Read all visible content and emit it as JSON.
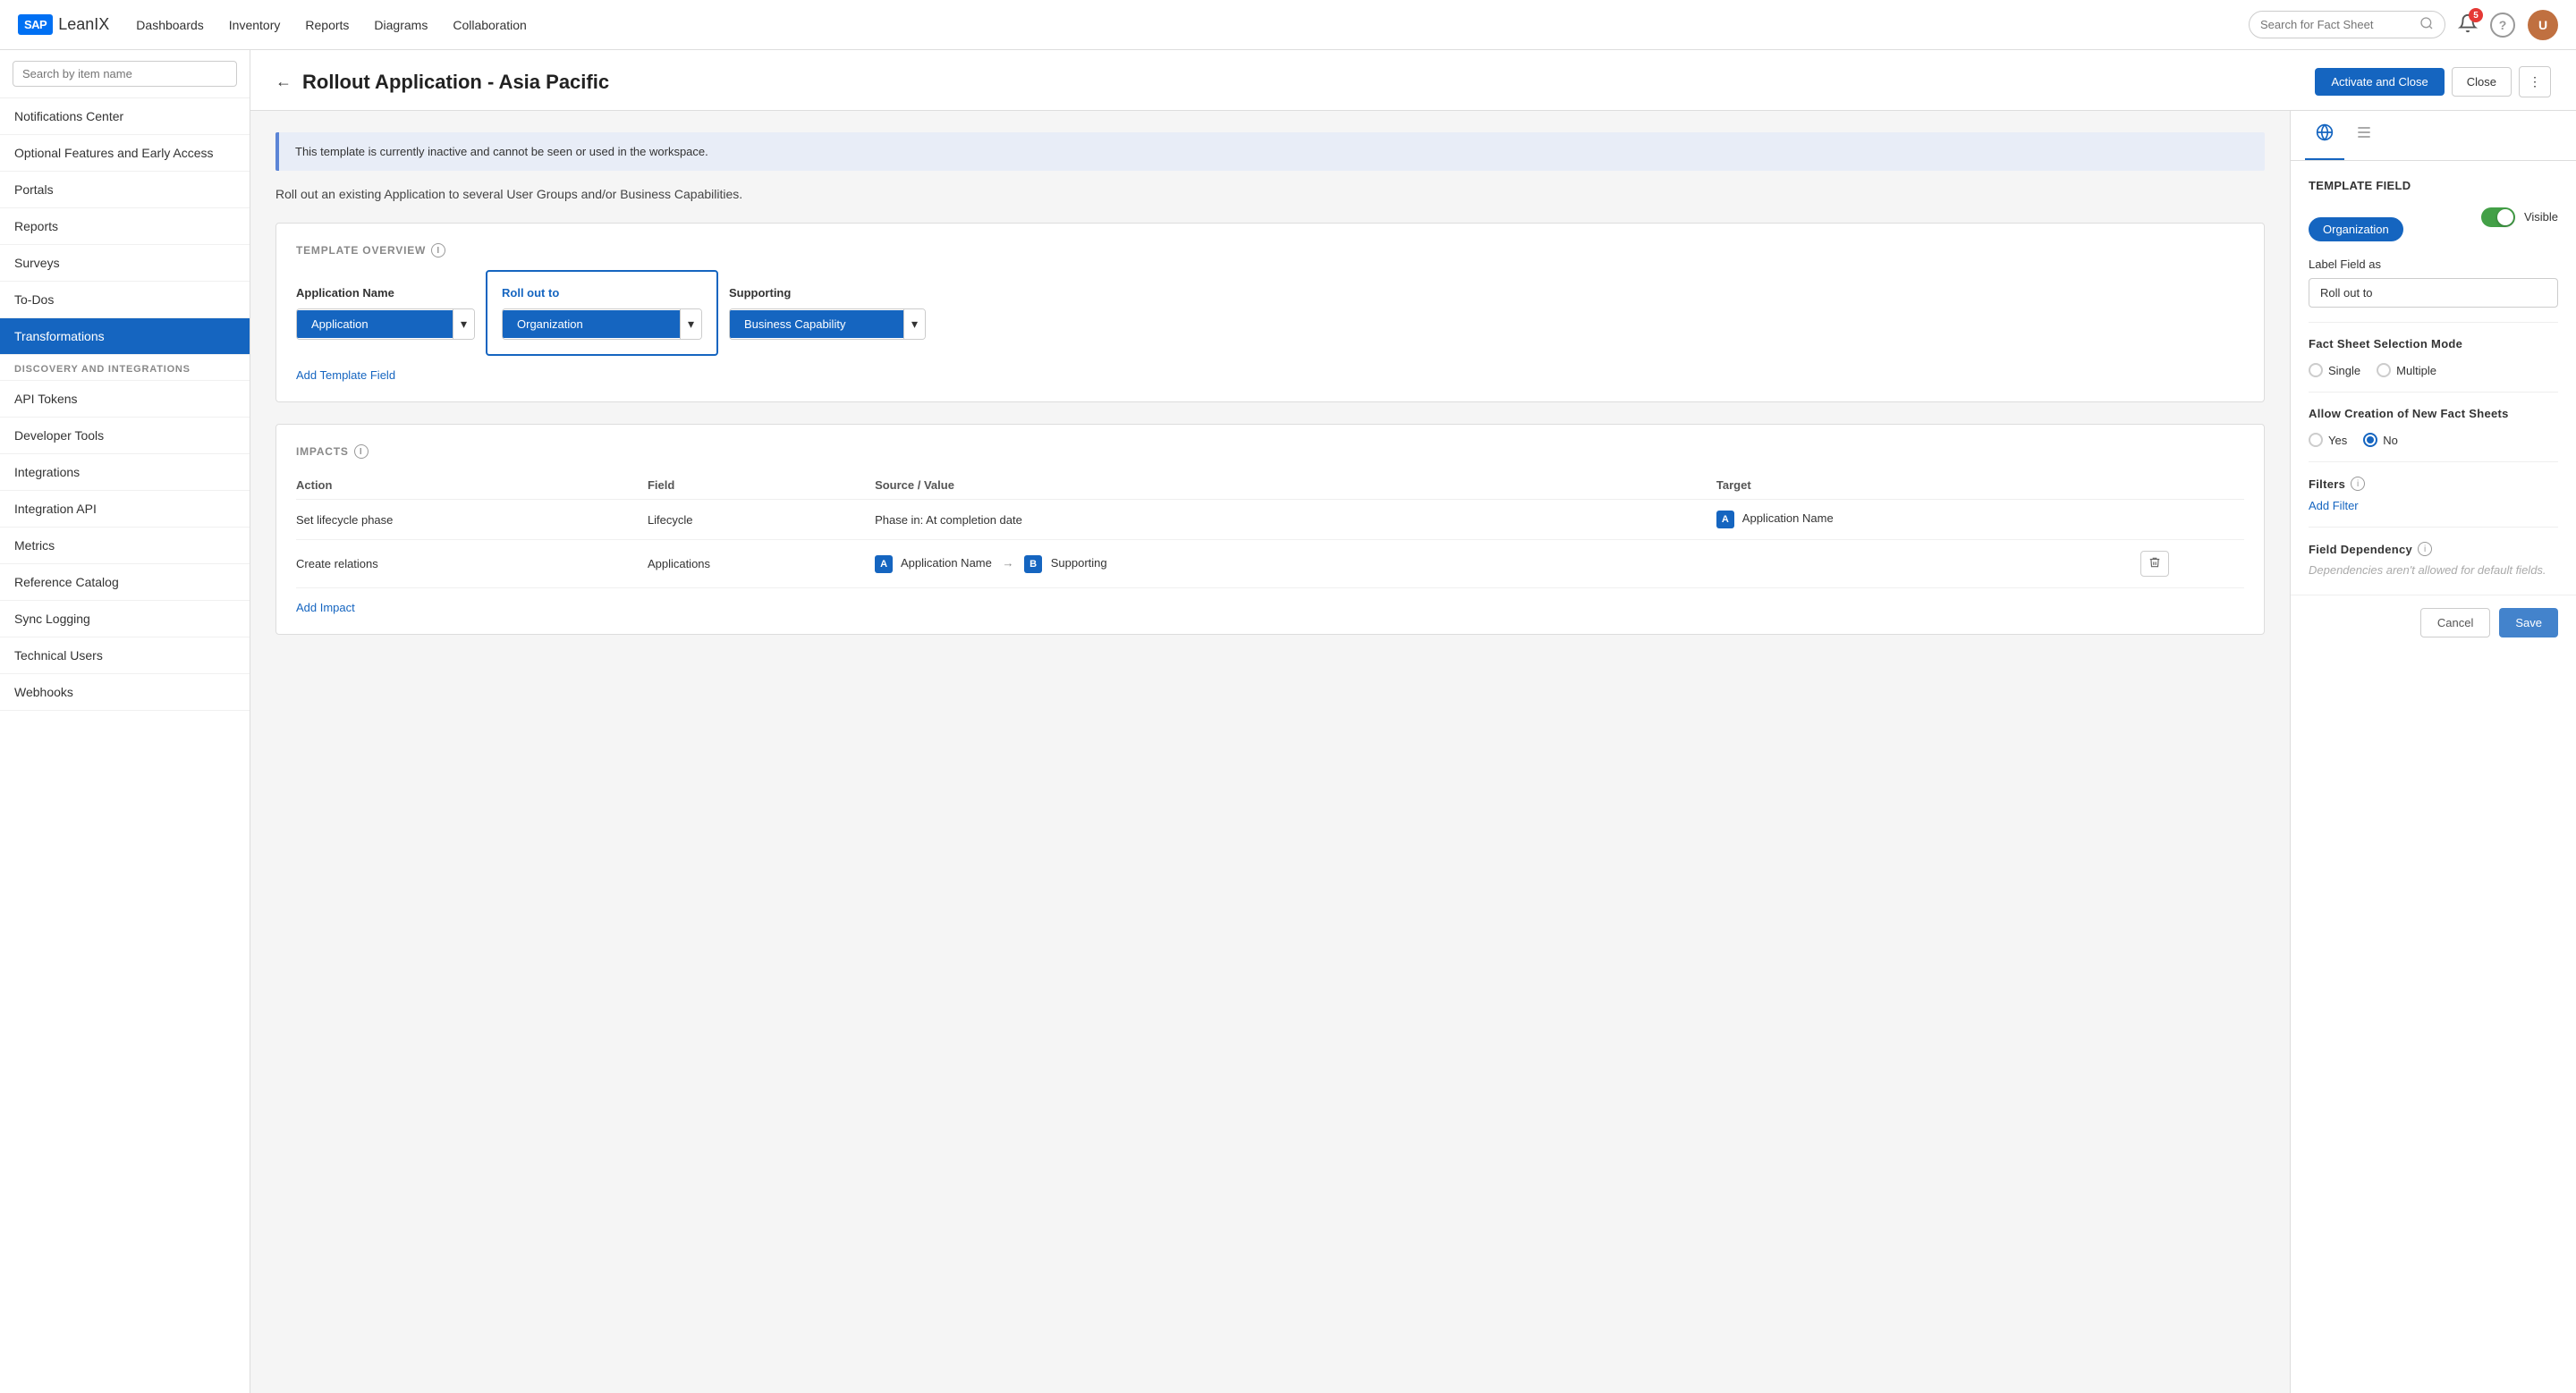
{
  "nav": {
    "logo_text": "LeanIX",
    "links": [
      "Dashboards",
      "Inventory",
      "Reports",
      "Diagrams",
      "Collaboration"
    ],
    "search_placeholder": "Search for Fact Sheet",
    "notif_count": "5"
  },
  "sidebar": {
    "search_placeholder": "Search by item name",
    "items_top": [
      {
        "id": "notifications-center",
        "label": "Notifications Center"
      },
      {
        "id": "optional-features",
        "label": "Optional Features and Early Access"
      },
      {
        "id": "portals",
        "label": "Portals"
      },
      {
        "id": "reports",
        "label": "Reports"
      },
      {
        "id": "surveys",
        "label": "Surveys"
      },
      {
        "id": "todos",
        "label": "To-Dos"
      },
      {
        "id": "transformations",
        "label": "Transformations",
        "active": true
      }
    ],
    "section_header": "DISCOVERY AND INTEGRATIONS",
    "items_bottom": [
      {
        "id": "api-tokens",
        "label": "API Tokens"
      },
      {
        "id": "developer-tools",
        "label": "Developer Tools"
      },
      {
        "id": "integrations",
        "label": "Integrations"
      },
      {
        "id": "integration-api",
        "label": "Integration API"
      },
      {
        "id": "metrics",
        "label": "Metrics"
      },
      {
        "id": "reference-catalog",
        "label": "Reference Catalog"
      },
      {
        "id": "sync-logging",
        "label": "Sync Logging"
      },
      {
        "id": "technical-users",
        "label": "Technical Users"
      },
      {
        "id": "webhooks",
        "label": "Webhooks"
      }
    ]
  },
  "page": {
    "title": "Rollout Application - Asia Pacific",
    "back_label": "←",
    "activate_close_label": "Activate and Close",
    "close_label": "Close",
    "info_banner": "This template is currently inactive and cannot be seen or used in the workspace.",
    "description": "Roll out an existing Application to several User Groups and/or Business Capabilities.",
    "template_overview_label": "TEMPLATE OVERVIEW",
    "impacts_label": "IMPACTS",
    "add_template_field_label": "Add Template Field",
    "add_impact_label": "Add Impact",
    "template_fields": [
      {
        "label": "Application Name",
        "value": "Application"
      },
      {
        "label": "Roll out to",
        "value": "Organization",
        "highlight": true
      },
      {
        "label": "Supporting",
        "value": "Business Capability"
      }
    ],
    "impacts_columns": [
      "Action",
      "Field",
      "Source / Value",
      "Target"
    ],
    "impacts_rows": [
      {
        "action": "Set lifecycle phase",
        "field": "Lifecycle",
        "source": "Phase in: At completion date",
        "target_tag": "A",
        "target": "Application Name",
        "has_delete": false
      },
      {
        "action": "Create relations",
        "field": "Applications",
        "source_tag": "A",
        "source_label": "Application Name",
        "arrow": "→",
        "target_tag": "B",
        "target": "Supporting",
        "has_delete": true
      }
    ]
  },
  "right_panel": {
    "template_field_title": "TEMPLATE FIELD",
    "org_tag": "Organization",
    "visible_label": "Visible",
    "label_field_title": "Label Field as",
    "label_field_value": "Roll out to",
    "fact_sheet_selection_title": "Fact Sheet Selection Mode",
    "single_label": "Single",
    "multiple_label": "Multiple",
    "allow_creation_title": "Allow Creation of New Fact Sheets",
    "yes_label": "Yes",
    "no_label": "No",
    "filters_title": "Filters",
    "add_filter_label": "Add Filter",
    "field_dependency_title": "Field Dependency",
    "dependency_note": "Dependencies aren't allowed for default fields.",
    "cancel_label": "Cancel",
    "save_label": "Save"
  }
}
